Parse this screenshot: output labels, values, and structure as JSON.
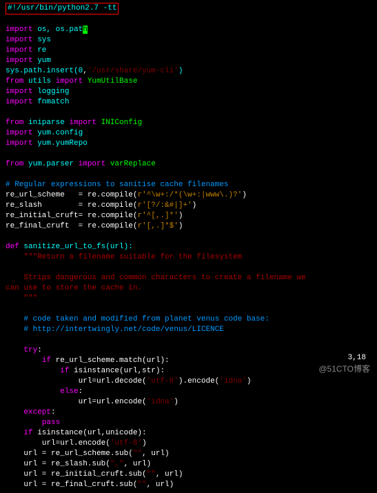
{
  "shebang": "#!/usr/bin/python2.7 -tt",
  "cur": "h",
  "l": {
    "i": "import",
    "f": "from",
    "d": "def",
    "tr": "try",
    "if": "if",
    "el": "else",
    "ex": "except",
    "ps": "pass",
    "os": " os, os.pat",
    "sys": " sys",
    "re": " re",
    "yum": " yum",
    "spi": "sys.path.insert(",
    "zero": "0",
    "spi2": ",",
    "spi3": "'/usr/share/yum-cli'",
    "spi4": ")",
    "ut": " utils ",
    "yub": " YumUtilBase",
    "log": " logging",
    "fn": " fnmatch",
    "ini": " iniparse ",
    "inic": " INIConfig",
    "yc": " yum.config",
    "yr": " yum.yumRepo",
    "yp": " yum.parser ",
    "vr": " varReplace",
    "c1": "# Regular expressions to sanitise cache filenames",
    "rus": "re_url_scheme   = re.compile(",
    "rus2": "r'^\\w+:/*(\\w+:|www\\.)?'",
    "rsl": "re_slash        = re.compile(",
    "rsl2": "r'[?/:&#|]+'",
    "ric": "re_initial_cruft= re.compile(",
    "ric2": "r'^[,.]*'",
    "rfc": "re_final_cruft  = re.compile(",
    "rfc2": "r'[,.]*$'",
    "def": " sanitize_url_to_fs(url):",
    "ds1": "\"\"\"Return a filename suitable for the filesystem",
    "ds2": "Strips dangerous and common characters to create a filename we",
    "ds3": "can use to store the cache in.",
    "ds4": "\"\"\"",
    "c2": "# code taken and modified from planet venus code base:",
    "c3": "# http://intertwingly.net/code/venus/LICENCE",
    "m1": " re_url_scheme.match(url):",
    "m2": " isinstance(url,str):",
    "m3": "url=url.decode(",
    "utf": "'utf-8'",
    "m3b": ").encode(",
    "idna": "'idna'",
    "m4": "url=url.encode(",
    "m5": " isinstance(url,unicode):",
    "u1": "url = re_url_scheme.sub(",
    "es": "\"\"",
    "u1b": ", url)",
    "u2": "url = re_slash.sub(",
    "comma": "\",\"",
    "u3": "url = re_initial_cruft.sub(",
    "u4": "url = re_final_cruft.sub("
  },
  "pos": "3,18",
  "wm": "@51CTO博客"
}
